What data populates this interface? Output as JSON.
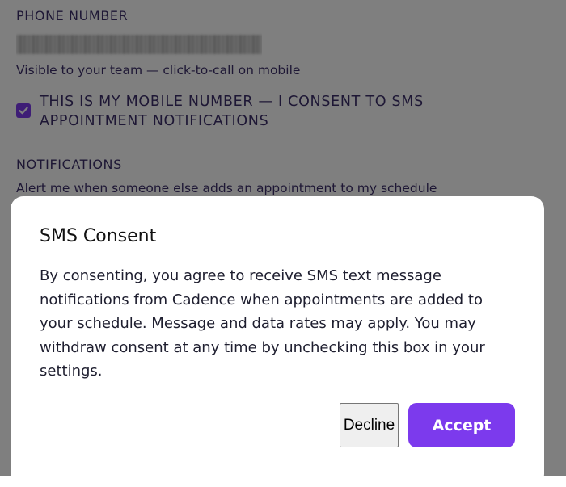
{
  "settings": {
    "phone_label": "PHONE NUMBER",
    "phone_hint": "Visible to your team — click-to-call on mobile",
    "sms_consent_label": "THIS IS MY MOBILE NUMBER — I CONSENT TO SMS APPOINTMENT NOTIFICATIONS",
    "sms_consent_checked": true,
    "notifications_label": "NOTIFICATIONS",
    "notifications_hint": "Alert me when someone else adds an appointment to my schedule"
  },
  "modal": {
    "title": "SMS Consent",
    "body": "By consenting, you agree to receive SMS text message notifications from Cadence when appointments are added to your schedule. Message and data rates may apply. You may withdraw consent at any time by unchecking this box in your settings.",
    "decline_label": "Decline",
    "accept_label": "Accept"
  },
  "icons": {
    "checkbox": "checkmark-icon"
  },
  "colors": {
    "accent": "#7c3aed",
    "text_label": "#3c2f6a",
    "overlay": "rgba(0,0,0,0.5)"
  }
}
